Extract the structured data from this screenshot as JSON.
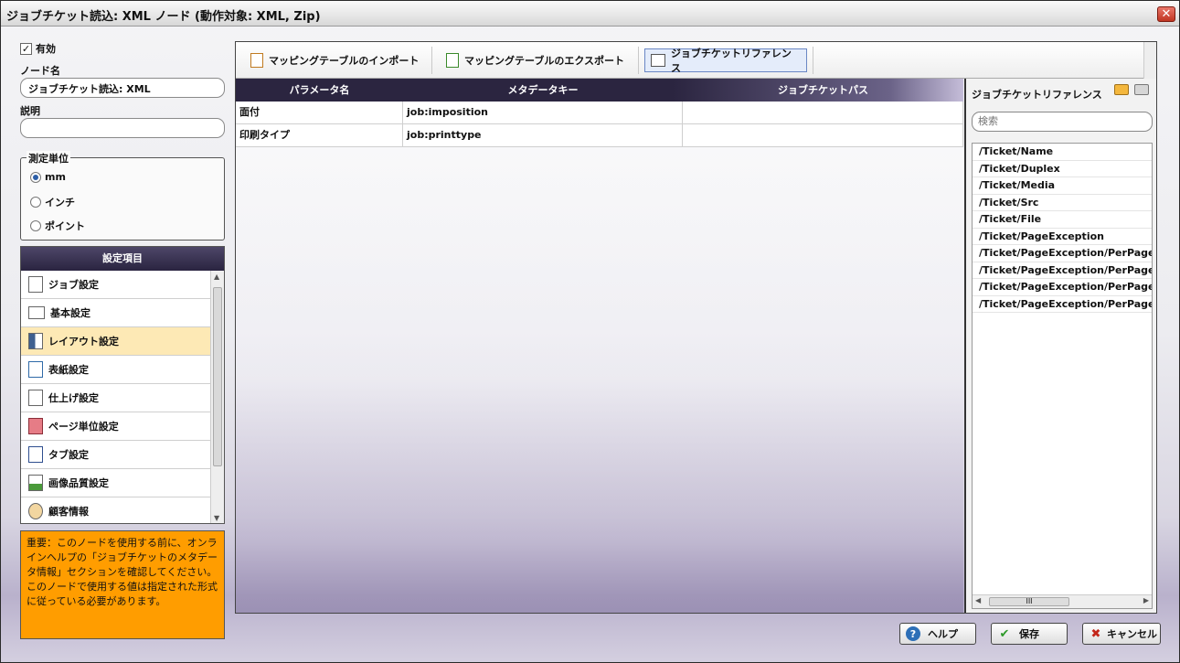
{
  "window": {
    "title": "ジョブチケット読込: XML ノード (動作対象: XML, Zip)",
    "close_glyph": "✕"
  },
  "left": {
    "enabled_label": "有効",
    "enabled_checked": true,
    "node_name_label": "ノード名",
    "node_name_value": "ジョブチケット読込: XML",
    "description_label": "説明",
    "description_value": "",
    "units": {
      "legend": "測定単位",
      "options": [
        "mm",
        "インチ",
        "ポイント"
      ],
      "selected": "mm"
    },
    "settings": {
      "header": "設定項目",
      "items": [
        {
          "label": "ジョブ設定",
          "icon": "document-icon"
        },
        {
          "label": "基本設定",
          "icon": "list-icon"
        },
        {
          "label": "レイアウト設定",
          "icon": "layout-icon"
        },
        {
          "label": "表紙設定",
          "icon": "cover-icon"
        },
        {
          "label": "仕上げ設定",
          "icon": "finishing-icon"
        },
        {
          "label": "ページ単位設定",
          "icon": "pages-icon"
        },
        {
          "label": "タブ設定",
          "icon": "tab-icon"
        },
        {
          "label": "画像品質設定",
          "icon": "image-icon"
        },
        {
          "label": "顧客情報",
          "icon": "customer-icon"
        }
      ],
      "selected_index": 2
    },
    "note": "重要：このノードを使用する前に、オンラインヘルプの「ジョブチケットのメタデータ情報」セクションを確認してください。このノードで使用する値は指定された形式に従っている必要があります。"
  },
  "toolbar": {
    "import_label": "マッピングテーブルのインポート",
    "export_label": "マッピングテーブルのエクスポート",
    "reference_label": "ジョブチケットリファレンス"
  },
  "table": {
    "headers": [
      "パラメータ名",
      "メタデータキー",
      "ジョブチケットパス"
    ],
    "rows": [
      [
        "面付",
        "job:imposition",
        ""
      ],
      [
        "印刷タイプ",
        "job:printtype",
        ""
      ]
    ]
  },
  "reference": {
    "title": "ジョブチケットリファレンス",
    "search_placeholder": "検索",
    "items": [
      "/Ticket/Name",
      "/Ticket/Duplex",
      "/Ticket/Media",
      "/Ticket/Src",
      "/Ticket/File",
      "/Ticket/PageException",
      "/Ticket/PageException/PerPageS",
      "/Ticket/PageException/PerPageS",
      "/Ticket/PageException/PerPageS",
      "/Ticket/PageException/PerPageS"
    ],
    "hscroll_glyph": "III"
  },
  "buttons": {
    "help": "ヘルプ",
    "save": "保存",
    "cancel": "キャンセル"
  },
  "colors": {
    "accent": "#2b2540",
    "note_bg": "#ff9d00",
    "selected_row": "#fde9b5"
  }
}
